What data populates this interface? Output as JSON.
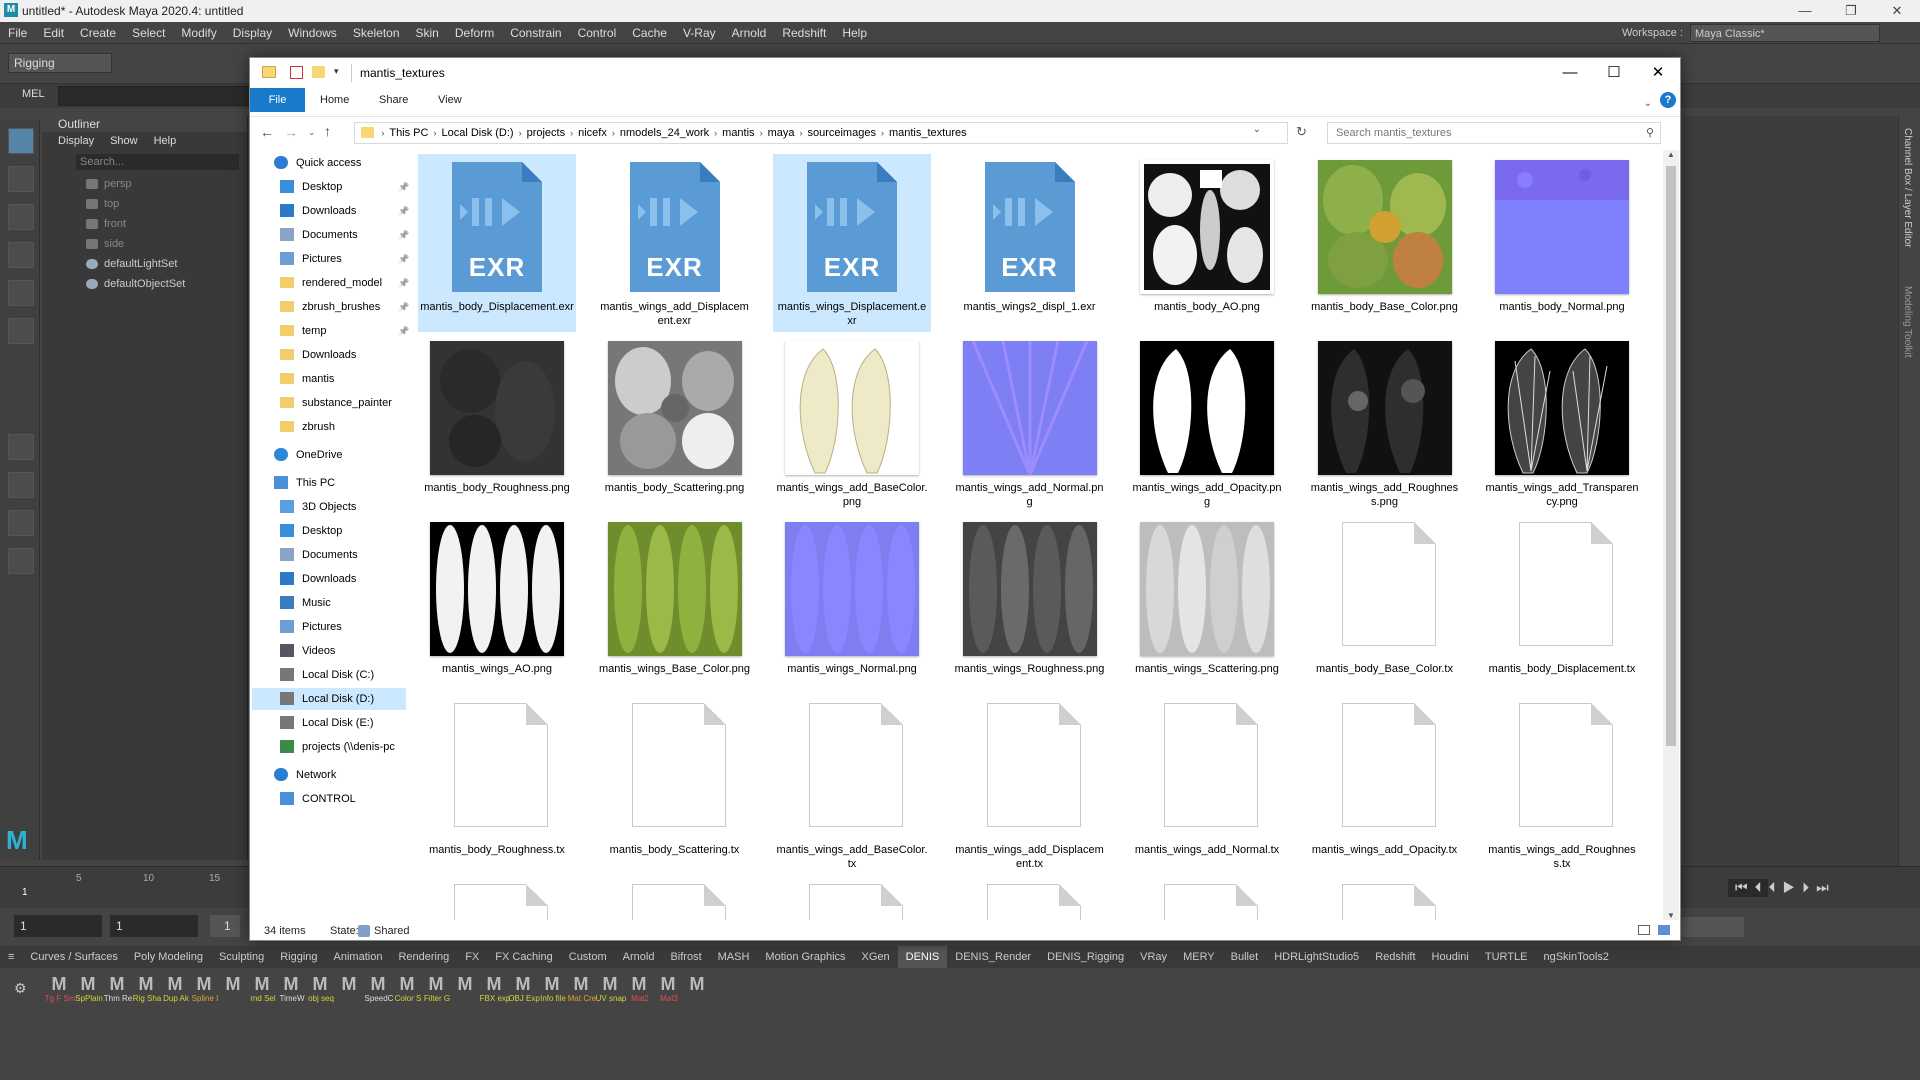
{
  "maya": {
    "title": "untitled* - Autodesk Maya 2020.4: untitled",
    "menu": [
      "File",
      "Edit",
      "Create",
      "Select",
      "Modify",
      "Display",
      "Windows",
      "Skeleton",
      "Skin",
      "Deform",
      "Constrain",
      "Control",
      "Cache",
      "V-Ray",
      "Arnold",
      "Redshift",
      "Help"
    ],
    "workspace_label": "Workspace :",
    "workspace_value": "Maya Classic*",
    "menuset": "Rigging",
    "mel": "MEL",
    "outliner": {
      "title": "Outliner",
      "menu": [
        "Display",
        "Show",
        "Help"
      ],
      "search_placeholder": "Search...",
      "items": [
        {
          "label": "persp",
          "dim": true
        },
        {
          "label": "top",
          "dim": true
        },
        {
          "label": "front",
          "dim": true
        },
        {
          "label": "side",
          "dim": true
        },
        {
          "label": "defaultLightSet",
          "dim": false
        },
        {
          "label": "defaultObjectSet",
          "dim": false
        }
      ]
    },
    "timeline_ticks": [
      "1",
      "5",
      "10",
      "15"
    ],
    "range_start": "1",
    "range_start2": "1",
    "range_field": "1",
    "side_tabs": [
      "Channel Box / Layer Editor",
      "Modeling Toolkit"
    ],
    "shelf_tabs": [
      "Curves / Surfaces",
      "Poly Modeling",
      "Sculpting",
      "Rigging",
      "Animation",
      "Rendering",
      "FX",
      "FX Caching",
      "Custom",
      "Arnold",
      "Bifrost",
      "MASH",
      "Motion Graphics",
      "XGen",
      "DENIS",
      "DENIS_Render",
      "DENIS_Rigging",
      "VRay",
      "MERY",
      "Bullet",
      "HDRLightStudio5",
      "Redshift",
      "Houdini",
      "TURTLE",
      "ngSkinTools2"
    ],
    "active_shelf_tab": "DENIS",
    "shelf_buttons": [
      {
        "label": "Tg F Sm",
        "color": "#e05050"
      },
      {
        "label": "SpPlain",
        "color": "#d4d43a"
      },
      {
        "label": "Thm Re",
        "color": "#dddddd"
      },
      {
        "label": "Rig Sha",
        "color": "#d4d43a"
      },
      {
        "label": "Dup Ak",
        "color": "#d4d43a"
      },
      {
        "label": "Spline I",
        "color": "#e0a030"
      },
      {
        "label": "",
        "color": "#dddddd"
      },
      {
        "label": "rnd Sel",
        "color": "#d4d43a"
      },
      {
        "label": "TimeW",
        "color": "#dddddd"
      },
      {
        "label": "obj seq",
        "color": "#d4d43a"
      },
      {
        "label": "",
        "color": "#dddddd"
      },
      {
        "label": "SpeedC",
        "color": "#dddddd"
      },
      {
        "label": "Color S",
        "color": "#d4d43a"
      },
      {
        "label": "Filter G",
        "color": "#d4d43a"
      },
      {
        "label": "",
        "color": "#dddddd"
      },
      {
        "label": "FBX exp",
        "color": "#d4d43a"
      },
      {
        "label": "OBJ Exp",
        "color": "#d4d43a"
      },
      {
        "label": "Info file",
        "color": "#d4d43a"
      },
      {
        "label": "Mat Cre",
        "color": "#e0a030"
      },
      {
        "label": "UV snap",
        "color": "#d4d43a"
      },
      {
        "label": "Mat2",
        "color": "#e05050"
      },
      {
        "label": "Mat3",
        "color": "#e05050"
      },
      {
        "label": "",
        "color": "#dddddd"
      }
    ]
  },
  "explorer": {
    "title": "mantis_textures",
    "ribbon": [
      "File",
      "Home",
      "Share",
      "View"
    ],
    "breadcrumbs": [
      "This PC",
      "Local Disk (D:)",
      "projects",
      "nicefx",
      "nmodels_24_work",
      "mantis",
      "maya",
      "sourceimages",
      "mantis_textures"
    ],
    "search_placeholder": "Search mantis_textures",
    "nav": [
      {
        "label": "Quick access",
        "type": "star",
        "indent": 0,
        "pin": false
      },
      {
        "label": "Desktop",
        "type": "desktop",
        "indent": 1,
        "pin": true
      },
      {
        "label": "Downloads",
        "type": "download",
        "indent": 1,
        "pin": true
      },
      {
        "label": "Documents",
        "type": "docs",
        "indent": 1,
        "pin": true
      },
      {
        "label": "Pictures",
        "type": "pics",
        "indent": 1,
        "pin": true
      },
      {
        "label": "rendered_model",
        "type": "folder",
        "indent": 1,
        "pin": true
      },
      {
        "label": "zbrush_brushes",
        "type": "folder",
        "indent": 1,
        "pin": true
      },
      {
        "label": "temp",
        "type": "folder",
        "indent": 1,
        "pin": true
      },
      {
        "label": "Downloads",
        "type": "folder",
        "indent": 1,
        "pin": false
      },
      {
        "label": "mantis",
        "type": "folder",
        "indent": 1,
        "pin": false
      },
      {
        "label": "substance_painter",
        "type": "folder",
        "indent": 1,
        "pin": false
      },
      {
        "label": "zbrush",
        "type": "folder",
        "indent": 1,
        "pin": false
      },
      {
        "label": "",
        "type": "gap",
        "indent": 0,
        "pin": false
      },
      {
        "label": "OneDrive",
        "type": "cloud",
        "indent": 0,
        "pin": false
      },
      {
        "label": "",
        "type": "gap",
        "indent": 0,
        "pin": false
      },
      {
        "label": "This PC",
        "type": "pc",
        "indent": 0,
        "pin": false
      },
      {
        "label": "3D Objects",
        "type": "obj3d",
        "indent": 1,
        "pin": false
      },
      {
        "label": "Desktop",
        "type": "desktop",
        "indent": 1,
        "pin": false
      },
      {
        "label": "Documents",
        "type": "docs",
        "indent": 1,
        "pin": false
      },
      {
        "label": "Downloads",
        "type": "download",
        "indent": 1,
        "pin": false
      },
      {
        "label": "Music",
        "type": "music",
        "indent": 1,
        "pin": false
      },
      {
        "label": "Pictures",
        "type": "pics",
        "indent": 1,
        "pin": false
      },
      {
        "label": "Videos",
        "type": "video",
        "indent": 1,
        "pin": false
      },
      {
        "label": "Local Disk (C:)",
        "type": "disk",
        "indent": 1,
        "pin": false
      },
      {
        "label": "Local Disk (D:)",
        "type": "disk",
        "indent": 1,
        "pin": false,
        "selected": true
      },
      {
        "label": "Local Disk (E:)",
        "type": "disk",
        "indent": 1,
        "pin": false
      },
      {
        "label": "projects (\\\\denis-pc",
        "type": "netdisk",
        "indent": 1,
        "pin": false
      },
      {
        "label": "",
        "type": "gap",
        "indent": 0,
        "pin": false
      },
      {
        "label": "Network",
        "type": "network",
        "indent": 0,
        "pin": false
      },
      {
        "label": "CONTROL",
        "type": "pc",
        "indent": 1,
        "pin": false
      }
    ],
    "files": [
      {
        "name": "mantis_body_Displacement.exr",
        "kind": "exr",
        "selected": true
      },
      {
        "name": "mantis_wings_add_Displacement.exr",
        "kind": "exr"
      },
      {
        "name": "mantis_wings_Displacement.exr",
        "kind": "exr",
        "selected": true
      },
      {
        "name": "mantis_wings2_displ_1.exr",
        "kind": "exr"
      },
      {
        "name": "mantis_body_AO.png",
        "kind": "body_ao"
      },
      {
        "name": "mantis_body_Base_Color.png",
        "kind": "body_color"
      },
      {
        "name": "mantis_body_Normal.png",
        "kind": "normal"
      },
      {
        "name": "mantis_body_Roughness.png",
        "kind": "body_rough"
      },
      {
        "name": "mantis_body_Scattering.png",
        "kind": "body_scatter"
      },
      {
        "name": "mantis_wings_add_BaseColor.png",
        "kind": "wings_add_color"
      },
      {
        "name": "mantis_wings_add_Normal.png",
        "kind": "wings_normal"
      },
      {
        "name": "mantis_wings_add_Opacity.png",
        "kind": "wings_opacity"
      },
      {
        "name": "mantis_wings_add_Roughness.png",
        "kind": "wings_rough"
      },
      {
        "name": "mantis_wings_add_Transparency.png",
        "kind": "wings_transp"
      },
      {
        "name": "mantis_wings_AO.png",
        "kind": "wings_ao"
      },
      {
        "name": "mantis_wings_Base_Color.png",
        "kind": "wings_color"
      },
      {
        "name": "mantis_wings_Normal.png",
        "kind": "wings4_normal"
      },
      {
        "name": "mantis_wings_Roughness.png",
        "kind": "wings4_rough"
      },
      {
        "name": "mantis_wings_Scattering.png",
        "kind": "wings4_scatter"
      },
      {
        "name": "mantis_body_Base_Color.tx",
        "kind": "doc"
      },
      {
        "name": "mantis_body_Displacement.tx",
        "kind": "doc"
      },
      {
        "name": "mantis_body_Roughness.tx",
        "kind": "doc"
      },
      {
        "name": "mantis_body_Scattering.tx",
        "kind": "doc"
      },
      {
        "name": "mantis_wings_add_BaseColor.tx",
        "kind": "doc"
      },
      {
        "name": "mantis_wings_add_Displacement.tx",
        "kind": "doc"
      },
      {
        "name": "mantis_wings_add_Normal.tx",
        "kind": "doc"
      },
      {
        "name": "mantis_wings_add_Opacity.tx",
        "kind": "doc"
      },
      {
        "name": "mantis_wings_add_Roughness.tx",
        "kind": "doc"
      },
      {
        "name": "",
        "kind": "doc"
      },
      {
        "name": "",
        "kind": "doc"
      },
      {
        "name": "",
        "kind": "doc"
      },
      {
        "name": "",
        "kind": "doc"
      },
      {
        "name": "",
        "kind": "doc"
      },
      {
        "name": "",
        "kind": "doc"
      }
    ],
    "status_count": "34 items",
    "status_state_label": "State:",
    "status_state_value": "Shared",
    "exr_label": "EXR"
  }
}
